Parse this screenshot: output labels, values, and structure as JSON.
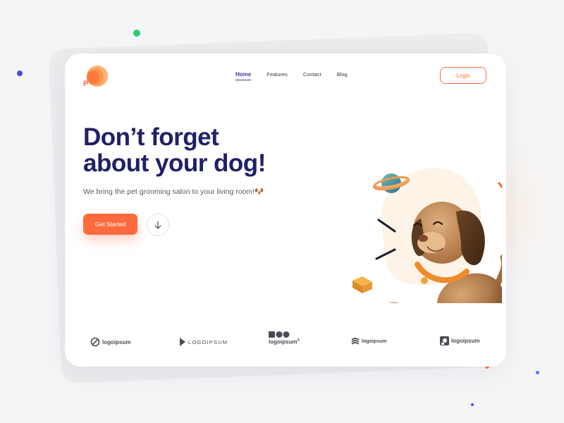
{
  "nav": {
    "logo_letter": "P",
    "items": [
      {
        "label": "Home",
        "active": true
      },
      {
        "label": "Features",
        "active": false
      },
      {
        "label": "Contact",
        "active": false
      },
      {
        "label": "Blog",
        "active": false
      }
    ],
    "login_label": "Login"
  },
  "hero": {
    "headline_line1": "Don’t forget",
    "headline_line2": "about your dog!",
    "subtitle": "We bring the pet grooming salon to your living room!🐶",
    "cta_label": "Get Started",
    "scroll_icon": "arrow-down-icon"
  },
  "partners": [
    {
      "text": "logoipsum",
      "icon": "slashed-circle-icon"
    },
    {
      "text": "LOGOIPSUM",
      "icon": "triangle-mark-icon"
    },
    {
      "text": "logoipsum",
      "icon": "square-circles-icon",
      "sup": "®"
    },
    {
      "text": "logoipsum",
      "icon": "stack-icon"
    },
    {
      "text": "logoipsum",
      "icon": "square-o-icon"
    }
  ],
  "colors": {
    "accent": "#ff6b3d",
    "brand_navy": "#202166",
    "nav_active": "#3b3a9a"
  }
}
